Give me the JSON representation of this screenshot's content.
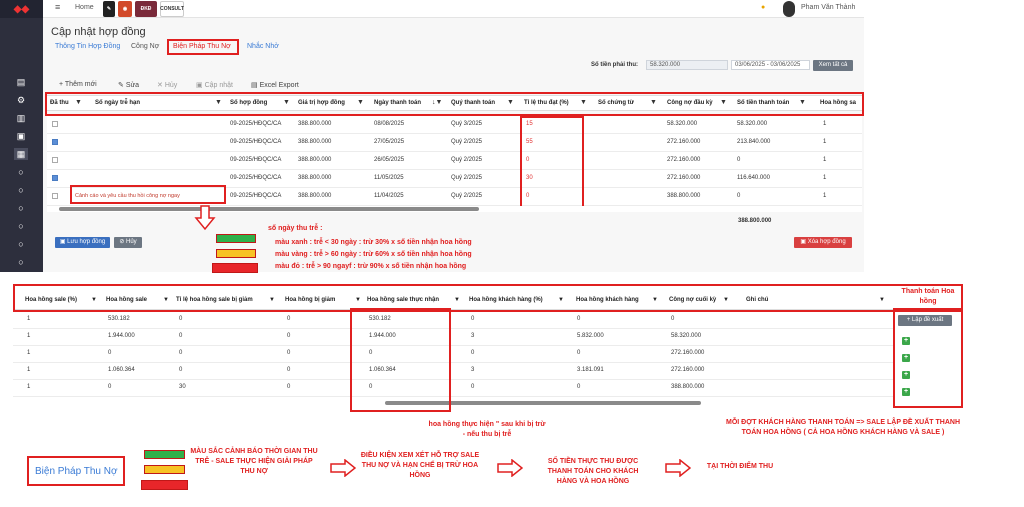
{
  "app": {
    "nav_home": "Home",
    "user_name": "Pham Văn Thành",
    "logos": [
      "ĐKĐ",
      "CONSULT"
    ]
  },
  "page": {
    "title": "Cập nhật hợp đồng",
    "tabs": [
      "Thông Tin Hợp Đồng",
      "Công Nợ",
      "Biện Pháp Thu Nợ",
      "Nhắc Nhở"
    ],
    "active_tab": "Biện Pháp Thu Nợ"
  },
  "filter": {
    "amount_label": "Số tiền phải thu:",
    "amount_value": "58.320.000",
    "date_range": "03/06/2025 - 03/06/2025",
    "view_all_button": "Xem tất cả"
  },
  "toolbar": {
    "add": "Thêm mới",
    "edit": "Sửa",
    "cancel": "Hủy",
    "update": "Cập nhật",
    "excel": "Excel Export"
  },
  "grid1": {
    "headers": [
      "Đã thu",
      "Số ngày trễ hạn",
      "Số hợp đồng",
      "Giá trị hợp đồng",
      "Ngày thanh toán",
      "Quý thanh toán",
      "Tỉ lệ thu đạt (%)",
      "Số chứng từ",
      "Công nợ đầu kỳ",
      "Số tiền thanh toán",
      "Hoa hồng sa"
    ],
    "rows": [
      {
        "checked": false,
        "late": "",
        "contract": "09-2025/HĐQC/CA",
        "value": "388.800.000",
        "date": "08/08/2025",
        "quarter": "Quý 3/2025",
        "rate": "15",
        "voucher": "",
        "opening": "58.320.000",
        "paid": "58.320.000",
        "commission": "1"
      },
      {
        "checked": true,
        "late": "",
        "contract": "09-2025/HĐQC/CA",
        "value": "388.800.000",
        "date": "27/05/2025",
        "quarter": "Quý 2/2025",
        "rate": "55",
        "voucher": "",
        "opening": "272.160.000",
        "paid": "213.840.000",
        "commission": "1"
      },
      {
        "checked": false,
        "late": "",
        "contract": "09-2025/HĐQC/CA",
        "value": "388.800.000",
        "date": "26/05/2025",
        "quarter": "Quý 2/2025",
        "rate": "0",
        "voucher": "",
        "opening": "272.160.000",
        "paid": "0",
        "commission": "1"
      },
      {
        "checked": true,
        "late": "",
        "contract": "09-2025/HĐQC/CA",
        "value": "388.800.000",
        "date": "11/05/2025",
        "quarter": "Quý 2/2025",
        "rate": "30",
        "voucher": "",
        "opening": "272.160.000",
        "paid": "116.640.000",
        "commission": "1"
      },
      {
        "checked": false,
        "late": "Cảnh cáo và yêu cầu thu hồi công nợ ngay",
        "contract": "09-2025/HĐQC/CA",
        "value": "388.800.000",
        "date": "11/04/2025",
        "quarter": "Quý 2/2025",
        "rate": "0",
        "voucher": "",
        "opening": "388.800.000",
        "paid": "0",
        "commission": "1"
      }
    ],
    "total_paid": "388.800.000",
    "save_button": "Lưu hợp đồng",
    "cancel_button": "Hủy",
    "delete_button": "Xóa hợp đồng"
  },
  "legend": {
    "title": "số ngày thu trễ :",
    "green": "màu xanh : trễ < 30 ngày : trừ 30% x số tiền nhận hoa hồng",
    "yellow": "màu vàng : trễ > 60 ngày : trừ 60% x số tiền nhận hoa hồng",
    "red": "màu đỏ : trễ > 90 ngayf : trừ 90% x số tiền nhận hoa hồng",
    "colors": {
      "green": "#2fb04a",
      "yellow": "#f7c325",
      "red": "#e8262a"
    }
  },
  "grid2": {
    "headers": [
      "Hoa hồng sale (%)",
      "Hoa hồng sale",
      "Tỉ lệ hoa hồng sale bị giảm",
      "Hoa hồng bị giảm",
      "Hoa hồng sale thực nhận",
      "Hoa hồng khách hàng (%)",
      "Hoa hồng khách hàng",
      "Công nợ cuối kỳ",
      "Ghi chú"
    ],
    "rows": [
      [
        "1",
        "530.182",
        "0",
        "0",
        "530.182",
        "0",
        "0",
        "0"
      ],
      [
        "1",
        "1.944.000",
        "0",
        "0",
        "1.944.000",
        "3",
        "5.832.000",
        "58.320.000"
      ],
      [
        "1",
        "0",
        "0",
        "0",
        "0",
        "0",
        "0",
        "272.160.000"
      ],
      [
        "1",
        "1.060.364",
        "0",
        "0",
        "1.060.364",
        "3",
        "3.181.091",
        "272.160.000"
      ],
      [
        "1",
        "0",
        "30",
        "0",
        "0",
        "0",
        "0",
        "388.800.000"
      ]
    ],
    "propose_button": "Lập đề xuất",
    "pay_header": "Thanh toán Hoa hồng"
  },
  "annotations": {
    "actual_commission": "hoa hồng thực hiện \" sau khi bị trừ - nếu thu bị trễ",
    "each_payment": "MỖI ĐỢT KHÁCH HÀNG THANH TOÁN => SALE LẬP ĐỀ XUẤT THANH TOÁN HOA HỒNG ( CẢ HOA HỒNG KHÁCH HÀNG VÀ  SALE )"
  },
  "flow": {
    "label": "Biện Pháp Thu Nợ",
    "step1": "MÀU SẮC CẢNH BÁO THỜI GIAN THU TRỄ - SALE THỰC HIỆN GIẢI PHÁP THU NỢ",
    "step2": "ĐIỀU KIỆN XEM XÉT HỖ TRỢ SALE THU NỢ VÀ HẠN CHẾ BỊ TRỪ HOA HỒNG",
    "step3": "SỐ TIỀN THỰC THU ĐƯỢC THANH TOÁN CHO KHÁCH HÀNG VÀ HOA HỒNG",
    "step4": "TẠI THỜI ĐIỂM THU"
  }
}
